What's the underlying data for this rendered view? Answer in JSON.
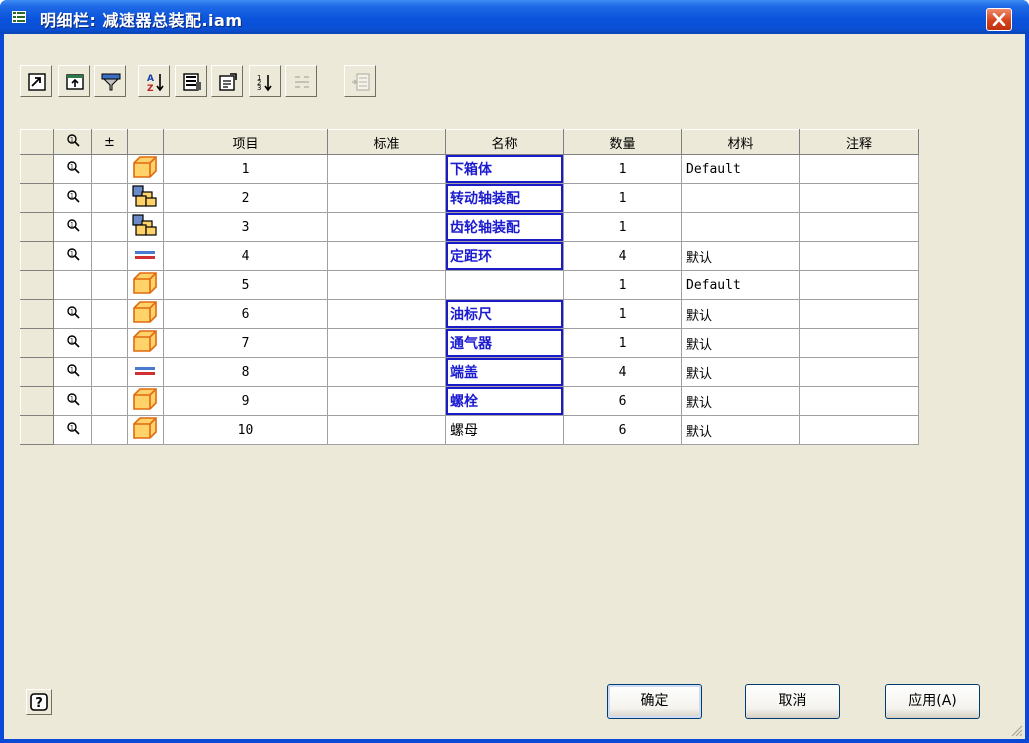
{
  "window": {
    "title": "明细栏: 减速器总装配.iam"
  },
  "toolbar": {
    "buttons": [
      {
        "icon": "view-options-icon",
        "enabled": true
      },
      {
        "icon": "export-icon",
        "enabled": true
      },
      {
        "icon": "filter-icon",
        "enabled": true
      },
      {
        "icon": "sort-az-icon",
        "enabled": true
      },
      {
        "icon": "column-chooser-icon",
        "enabled": true
      },
      {
        "icon": "properties-icon",
        "enabled": true
      },
      {
        "icon": "renumber-icon",
        "enabled": true
      },
      {
        "icon": "merge-rows-icon",
        "enabled": false
      },
      {
        "icon": "add-row-icon",
        "enabled": false
      }
    ]
  },
  "table": {
    "columns": [
      "",
      "⚲",
      "±",
      "",
      "项目",
      "标准",
      "名称",
      "数量",
      "材料",
      "注释"
    ],
    "rows": [
      {
        "visible_icon": true,
        "part_icon": "part",
        "item": "1",
        "standard": "",
        "name": "下箱体",
        "qty": "1",
        "material": "Default",
        "note": "",
        "selected": true
      },
      {
        "visible_icon": true,
        "part_icon": "assembly",
        "item": "2",
        "standard": "",
        "name": "转动轴装配",
        "qty": "1",
        "material": "",
        "note": "",
        "selected": true
      },
      {
        "visible_icon": true,
        "part_icon": "assembly",
        "item": "3",
        "standard": "",
        "name": "齿轮轴装配",
        "qty": "1",
        "material": "",
        "note": "",
        "selected": true
      },
      {
        "visible_icon": true,
        "part_icon": "sheet",
        "item": "4",
        "standard": "",
        "name": "定距环",
        "qty": "4",
        "material": "默认",
        "note": "",
        "selected": true
      },
      {
        "visible_icon": false,
        "part_icon": "part",
        "item": "5",
        "standard": "",
        "name": "",
        "qty": "1",
        "material": "Default",
        "note": "",
        "selected": false
      },
      {
        "visible_icon": true,
        "part_icon": "part",
        "item": "6",
        "standard": "",
        "name": "油标尺",
        "qty": "1",
        "material": "默认",
        "note": "",
        "selected": true
      },
      {
        "visible_icon": true,
        "part_icon": "part",
        "item": "7",
        "standard": "",
        "name": "通气器",
        "qty": "1",
        "material": "默认",
        "note": "",
        "selected": true
      },
      {
        "visible_icon": true,
        "part_icon": "sheet",
        "item": "8",
        "standard": "",
        "name": "端盖",
        "qty": "4",
        "material": "默认",
        "note": "",
        "selected": true
      },
      {
        "visible_icon": true,
        "part_icon": "part",
        "item": "9",
        "standard": "",
        "name": "螺栓",
        "qty": "6",
        "material": "默认",
        "note": "",
        "selected": true
      },
      {
        "visible_icon": true,
        "part_icon": "part",
        "item": "10",
        "standard": "",
        "name": "螺母",
        "qty": "6",
        "material": "默认",
        "note": "",
        "selected": false,
        "editing": true
      }
    ]
  },
  "buttons": {
    "ok": "确定",
    "cancel": "取消",
    "apply": "应用(A)"
  },
  "colors": {
    "title_bar": "#0a53dc",
    "face": "#ece9d8",
    "selection_border": "#1a1ac8",
    "close": "#d4431d"
  }
}
